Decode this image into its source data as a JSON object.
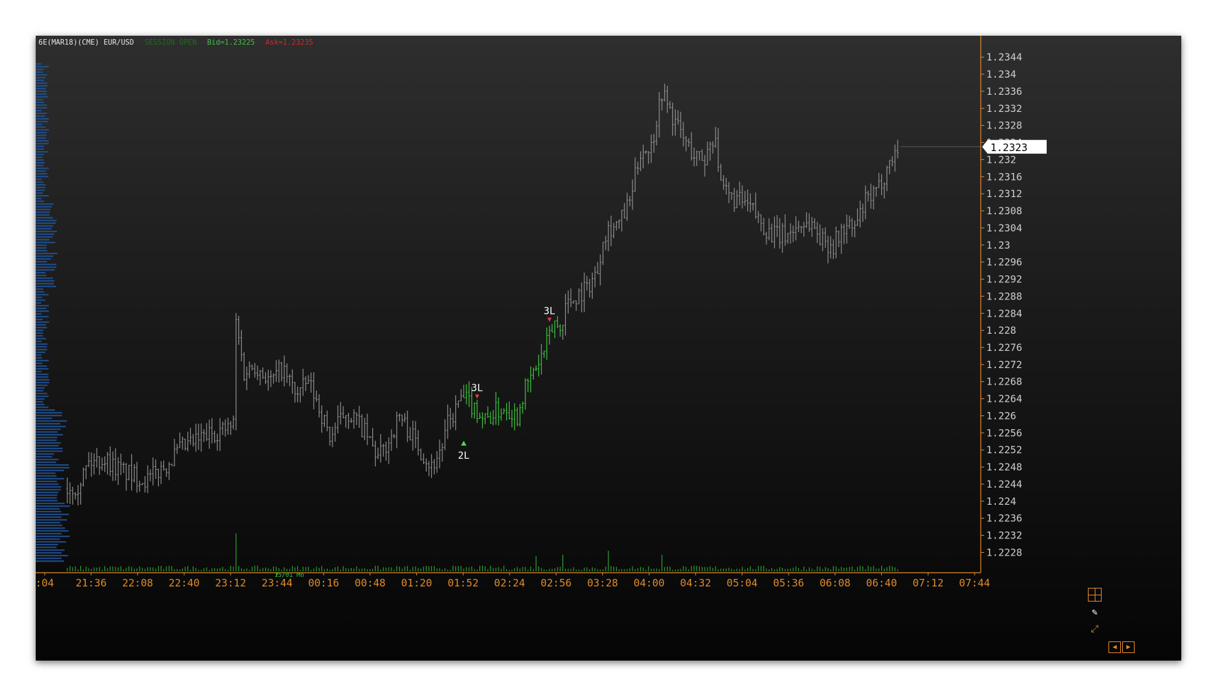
{
  "header": {
    "instrument": "6E(MAR18)(CME) EUR/USD",
    "session": "SESSION OPEN",
    "bid": "Bid=1.23225",
    "ask": "Ask=1.23235"
  },
  "colors": {
    "axis": "#e08a2a",
    "up_bar": "#3fc23f",
    "neutral_bar": "#8c8c8c",
    "volume": "#2e9e2e",
    "profile": "#1f4f8f",
    "bid": "#3fc23f",
    "ask": "#d42a2a",
    "session": "#1e6e1e"
  },
  "current_price_label": "1.2323",
  "date_marker_label": "15/01 Mo",
  "chart_data": {
    "type": "ohlc",
    "title": "",
    "y_ticks": [
      "1.2344",
      "1.234",
      "1.2336",
      "1.2332",
      "1.2328",
      "1.2324",
      "1.232",
      "1.2316",
      "1.2312",
      "1.2308",
      "1.2304",
      "1.23",
      "1.2296",
      "1.2292",
      "1.2288",
      "1.2284",
      "1.228",
      "1.2276",
      "1.2272",
      "1.2268",
      "1.2264",
      "1.226",
      "1.2256",
      "1.2252",
      "1.2248",
      "1.2244",
      "1.224",
      "1.2236",
      "1.2232",
      "1.2228"
    ],
    "x_ticks": [
      ":04",
      "21:36",
      "22:08",
      "22:40",
      "23:12",
      "23:44",
      "00:16",
      "00:48",
      "01:20",
      "01:52",
      "02:24",
      "02:56",
      "03:28",
      "04:00",
      "04:32",
      "05:04",
      "05:36",
      "06:08",
      "06:40",
      "07:12",
      "07:44"
    ],
    "ylim": [
      1.22255,
      1.23458
    ],
    "current_price": 1.2323,
    "price_path": [
      [
        0,
        1.2243
      ],
      [
        4,
        1.2244
      ],
      [
        8,
        1.2249
      ],
      [
        14,
        1.225
      ],
      [
        18,
        1.2248
      ],
      [
        24,
        1.2246
      ],
      [
        30,
        1.2245
      ],
      [
        36,
        1.2248
      ],
      [
        42,
        1.2252
      ],
      [
        48,
        1.2254
      ],
      [
        54,
        1.2256
      ],
      [
        60,
        1.2257
      ],
      [
        62,
        1.2258
      ],
      [
        63,
        1.2282
      ],
      [
        66,
        1.227
      ],
      [
        70,
        1.2272
      ],
      [
        76,
        1.2268
      ],
      [
        80,
        1.2271
      ],
      [
        86,
        1.2265
      ],
      [
        90,
        1.2268
      ],
      [
        94,
        1.2262
      ],
      [
        98,
        1.2255
      ],
      [
        104,
        1.2261
      ],
      [
        108,
        1.2259
      ],
      [
        112,
        1.2255
      ],
      [
        116,
        1.225
      ],
      [
        120,
        1.2254
      ],
      [
        124,
        1.226
      ],
      [
        128,
        1.2256
      ],
      [
        132,
        1.2252
      ],
      [
        136,
        1.2248
      ],
      [
        140,
        1.2253
      ],
      [
        142,
        1.2258
      ],
      [
        144,
        1.226
      ],
      [
        146,
        1.2263
      ],
      [
        148,
        1.2264
      ],
      [
        152,
        1.2262
      ],
      [
        156,
        1.2259
      ],
      [
        160,
        1.2261
      ],
      [
        164,
        1.2262
      ],
      [
        168,
        1.226
      ],
      [
        170,
        1.2265
      ],
      [
        174,
        1.227
      ],
      [
        178,
        1.2275
      ],
      [
        182,
        1.2282
      ],
      [
        184,
        1.228
      ],
      [
        186,
        1.2286
      ],
      [
        190,
        1.2288
      ],
      [
        194,
        1.229
      ],
      [
        198,
        1.2294
      ],
      [
        200,
        1.2302
      ],
      [
        202,
        1.2304
      ],
      [
        206,
        1.2305
      ],
      [
        210,
        1.231
      ],
      [
        214,
        1.2322
      ],
      [
        218,
        1.2323
      ],
      [
        222,
        1.2336
      ],
      [
        226,
        1.233
      ],
      [
        230,
        1.2325
      ],
      [
        234,
        1.2321
      ],
      [
        238,
        1.232
      ],
      [
        240,
        1.2324
      ],
      [
        242,
        1.2326
      ],
      [
        244,
        1.2313
      ],
      [
        248,
        1.2311
      ],
      [
        252,
        1.231
      ],
      [
        256,
        1.2308
      ],
      [
        258,
        1.2306
      ],
      [
        262,
        1.2303
      ],
      [
        266,
        1.2302
      ],
      [
        270,
        1.2303
      ],
      [
        274,
        1.2305
      ],
      [
        278,
        1.2305
      ],
      [
        282,
        1.2301
      ],
      [
        286,
        1.23
      ],
      [
        290,
        1.2304
      ],
      [
        294,
        1.2304
      ],
      [
        298,
        1.231
      ],
      [
        302,
        1.2312
      ],
      [
        306,
        1.2318
      ],
      [
        310,
        1.2323
      ]
    ],
    "up_segment": [
      148,
      184
    ],
    "signals": [
      {
        "label": "2L",
        "bar": 148,
        "price": 1.22535,
        "kind": "buy"
      },
      {
        "label": "3L",
        "bar": 153,
        "price": 1.22645,
        "kind": "sell"
      },
      {
        "label": "3L",
        "bar": 180,
        "price": 1.22825,
        "kind": "sell"
      }
    ],
    "volume": {
      "baseline": 18,
      "spikes": [
        [
          63,
          55
        ],
        [
          175,
          22
        ],
        [
          185,
          24
        ],
        [
          202,
          30
        ],
        [
          222,
          24
        ]
      ]
    },
    "grid": false,
    "legend": "none"
  }
}
